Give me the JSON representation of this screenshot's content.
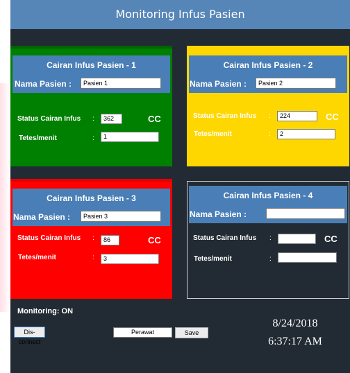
{
  "window": {
    "title": "Monitoring Infus Pasien"
  },
  "colors": {
    "panel1": "#008000",
    "panel2": "#ffd700",
    "panel3": "#ff0000",
    "panel4": "#222b33",
    "header": "#4a7eb6"
  },
  "panels": [
    {
      "title": "Cairan Infus Pasien - 1",
      "name_label": "Nama Pasien :",
      "name_value": "Pasien 1",
      "status_label": "Status Cairan Infus",
      "status_value": "362",
      "unit": "CC",
      "rate_label": "Tetes/menit",
      "rate_value": "1"
    },
    {
      "title": "Cairan Infus Pasien - 2",
      "name_label": "Nama Pasien :",
      "name_value": "Pasien 2",
      "status_label": "Status Cairan Infus",
      "status_value": "224",
      "unit": "CC",
      "rate_label": "Tetes/menit",
      "rate_value": "2"
    },
    {
      "title": "Cairan Infus Pasien - 3",
      "name_label": "Nama Pasien :",
      "name_value": "Pasien 3",
      "status_label": "Status Cairan Infus",
      "status_value": "86",
      "unit": "CC",
      "rate_label": "Tetes/menit",
      "rate_value": "3"
    },
    {
      "title": "Cairan Infus Pasien - 4",
      "name_label": "Nama Pasien :",
      "name_value": "",
      "status_label": "Status Cairan Infus",
      "status_value": "",
      "unit": "CC",
      "rate_label": "Tetes/menit",
      "rate_value": ""
    }
  ],
  "colon": ":",
  "status": {
    "text": "Monitoring: ON"
  },
  "controls": {
    "disconnect_label": "Dis-connect",
    "perawat_value": "Perawat",
    "save_label": "Save"
  },
  "clock": {
    "date": "8/24/2018",
    "time": "6:37:17 AM"
  }
}
